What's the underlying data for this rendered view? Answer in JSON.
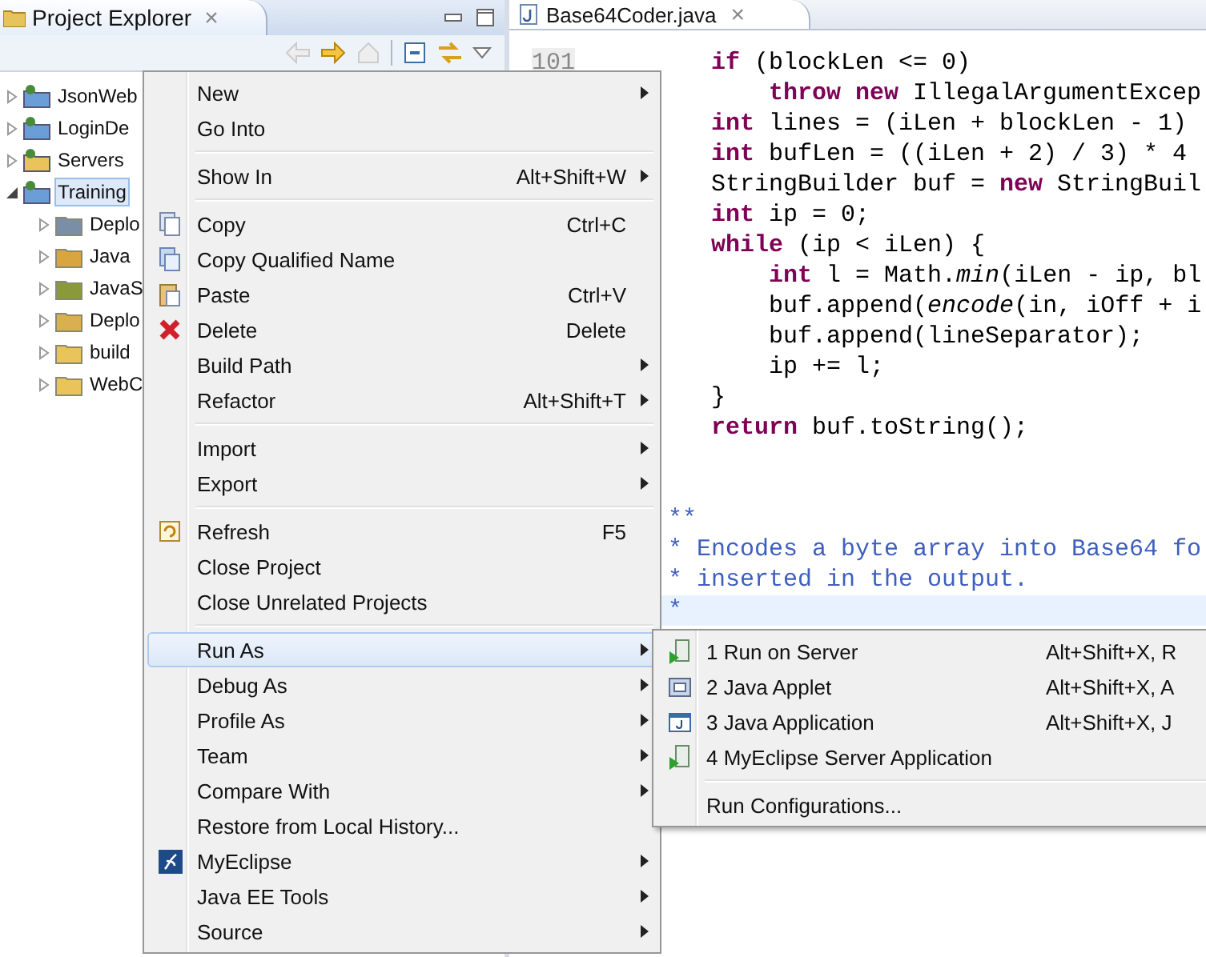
{
  "explorer": {
    "title": "Project Explorer",
    "close": "×",
    "tree": [
      {
        "label": "JsonWeb",
        "kind": "web",
        "expanded": false,
        "selected": false
      },
      {
        "label": "LoginDe",
        "kind": "web",
        "expanded": false,
        "selected": false
      },
      {
        "label": "Servers",
        "kind": "folder",
        "expanded": false,
        "selected": false
      },
      {
        "label": "Training",
        "kind": "web",
        "expanded": true,
        "selected": true,
        "children": [
          {
            "label": "Deplo",
            "kind": "descriptor",
            "expanded": false,
            "selected": false
          },
          {
            "label": "Java",
            "kind": "resources",
            "expanded": false,
            "selected": false
          },
          {
            "label": "JavaS",
            "kind": "library",
            "expanded": false,
            "selected": false
          },
          {
            "label": "Deplo",
            "kind": "deployed",
            "expanded": false,
            "selected": false
          },
          {
            "label": "build",
            "kind": "folder",
            "expanded": false,
            "selected": false
          },
          {
            "label": "WebC",
            "kind": "folder",
            "expanded": false,
            "selected": false
          }
        ]
      }
    ]
  },
  "editor": {
    "tab": "Base64Coder.java",
    "close": "×",
    "line_number": "101",
    "lines": [
      {
        "kind": "body",
        "current": false,
        "tokens": [
          {
            "text": "if",
            "kind": "keyword"
          },
          {
            "text": " (blockLen <= 0)",
            "kind": "plain"
          }
        ]
      },
      {
        "kind": "inner",
        "current": false,
        "tokens": [
          {
            "text": "throw new",
            "kind": "keyword"
          },
          {
            "text": " IllegalArgumentExcep",
            "kind": "plain"
          }
        ]
      },
      {
        "kind": "body",
        "current": false,
        "tokens": [
          {
            "text": "int",
            "kind": "keyword"
          },
          {
            "text": " lines = (iLen + blockLen - 1)",
            "kind": "plain"
          }
        ]
      },
      {
        "kind": "body",
        "current": false,
        "tokens": [
          {
            "text": "int",
            "kind": "keyword"
          },
          {
            "text": " bufLen = ((iLen + 2) / 3) * 4",
            "kind": "plain"
          }
        ]
      },
      {
        "kind": "body",
        "current": false,
        "tokens": [
          {
            "text": "StringBuilder buf = ",
            "kind": "plain"
          },
          {
            "text": "new",
            "kind": "keyword"
          },
          {
            "text": " StringBuil",
            "kind": "plain"
          }
        ]
      },
      {
        "kind": "body",
        "current": false,
        "tokens": [
          {
            "text": "int",
            "kind": "keyword"
          },
          {
            "text": " ip = 0;",
            "kind": "plain"
          }
        ]
      },
      {
        "kind": "body",
        "current": false,
        "tokens": [
          {
            "text": "while",
            "kind": "keyword"
          },
          {
            "text": " (ip < iLen) {",
            "kind": "plain"
          }
        ]
      },
      {
        "kind": "inner",
        "current": false,
        "tokens": [
          {
            "text": "int",
            "kind": "keyword"
          },
          {
            "text": " l = Math.",
            "kind": "plain"
          },
          {
            "text": "min",
            "kind": "italic"
          },
          {
            "text": "(iLen - ip, bl",
            "kind": "plain"
          }
        ]
      },
      {
        "kind": "inner",
        "current": false,
        "tokens": [
          {
            "text": "buf.append(",
            "kind": "plain"
          },
          {
            "text": "encode",
            "kind": "italic"
          },
          {
            "text": "(in, iOff + i",
            "kind": "plain"
          }
        ]
      },
      {
        "kind": "inner",
        "current": false,
        "tokens": [
          {
            "text": "buf.append(lineSeparator);",
            "kind": "plain"
          }
        ]
      },
      {
        "kind": "inner",
        "current": false,
        "tokens": [
          {
            "text": "ip += l;",
            "kind": "plain"
          }
        ]
      },
      {
        "kind": "body",
        "current": false,
        "tokens": [
          {
            "text": "}",
            "kind": "plain"
          }
        ]
      },
      {
        "kind": "body",
        "current": false,
        "tokens": [
          {
            "text": "return",
            "kind": "keyword"
          },
          {
            "text": " buf.toString();",
            "kind": "plain"
          }
        ]
      },
      {
        "kind": "blank",
        "current": false
      },
      {
        "kind": "blank",
        "current": false
      },
      {
        "kind": "doc",
        "current": false,
        "text": "**"
      },
      {
        "kind": "doc",
        "current": false,
        "text": "* Encodes a byte array into Base64 fo"
      },
      {
        "kind": "doc",
        "current": false,
        "text": "* inserted in the output."
      },
      {
        "kind": "doc",
        "current": true,
        "text": "*"
      }
    ]
  },
  "context_menu": {
    "groups": [
      [
        {
          "label": "New",
          "kind": "plain",
          "submenu": true,
          "selected": false
        },
        {
          "label": "Go Into",
          "kind": "plain",
          "submenu": false,
          "selected": false
        }
      ],
      [
        {
          "label": "Show In",
          "kind": "plain",
          "shortcut": "Alt+Shift+W",
          "submenu": true,
          "selected": false
        }
      ],
      [
        {
          "label": "Copy",
          "kind": "copy",
          "shortcut": "Ctrl+C",
          "submenu": false,
          "selected": false
        },
        {
          "label": "Copy Qualified Name",
          "kind": "copy-qualified",
          "submenu": false,
          "selected": false
        },
        {
          "label": "Paste",
          "kind": "paste",
          "shortcut": "Ctrl+V",
          "submenu": false,
          "selected": false
        },
        {
          "label": "Delete",
          "kind": "delete",
          "shortcut": "Delete",
          "submenu": false,
          "selected": false
        },
        {
          "label": "Build Path",
          "kind": "plain",
          "submenu": true,
          "selected": false
        },
        {
          "label": "Refactor",
          "kind": "plain",
          "shortcut": "Alt+Shift+T",
          "submenu": true,
          "selected": false
        }
      ],
      [
        {
          "label": "Import",
          "kind": "plain",
          "submenu": true,
          "selected": false
        },
        {
          "label": "Export",
          "kind": "plain",
          "submenu": true,
          "selected": false
        }
      ],
      [
        {
          "label": "Refresh",
          "kind": "refresh",
          "shortcut": "F5",
          "submenu": false,
          "selected": false
        },
        {
          "label": "Close Project",
          "kind": "plain",
          "submenu": false,
          "selected": false
        },
        {
          "label": "Close Unrelated Projects",
          "kind": "plain",
          "submenu": false,
          "selected": false
        }
      ],
      [
        {
          "label": "Run As",
          "kind": "plain",
          "submenu": true,
          "selected": true
        },
        {
          "label": "Debug As",
          "kind": "plain",
          "submenu": true,
          "selected": false
        },
        {
          "label": "Profile As",
          "kind": "plain",
          "submenu": true,
          "selected": false
        },
        {
          "label": "Team",
          "kind": "plain",
          "submenu": true,
          "selected": false
        },
        {
          "label": "Compare With",
          "kind": "plain",
          "submenu": true,
          "selected": false
        },
        {
          "label": "Restore from Local History...",
          "kind": "plain",
          "submenu": false,
          "selected": false
        },
        {
          "label": "MyEclipse",
          "kind": "myeclipse",
          "submenu": true,
          "selected": false
        },
        {
          "label": "Java EE Tools",
          "kind": "plain",
          "submenu": true,
          "selected": false
        },
        {
          "label": "Source",
          "kind": "plain",
          "submenu": true,
          "selected": false
        }
      ]
    ]
  },
  "run_as_submenu": {
    "groups": [
      [
        {
          "label": "1 Run on Server",
          "kind": "server",
          "shortcut": "Alt+Shift+X, R"
        },
        {
          "label": "2 Java Applet",
          "kind": "applet",
          "shortcut": "Alt+Shift+X, A"
        },
        {
          "label": "3 Java Application",
          "kind": "application",
          "shortcut": "Alt+Shift+X, J"
        },
        {
          "label": "4 MyEclipse Server Application",
          "kind": "server"
        }
      ],
      [
        {
          "label": "Run Configurations...",
          "kind": "plain"
        }
      ]
    ]
  }
}
